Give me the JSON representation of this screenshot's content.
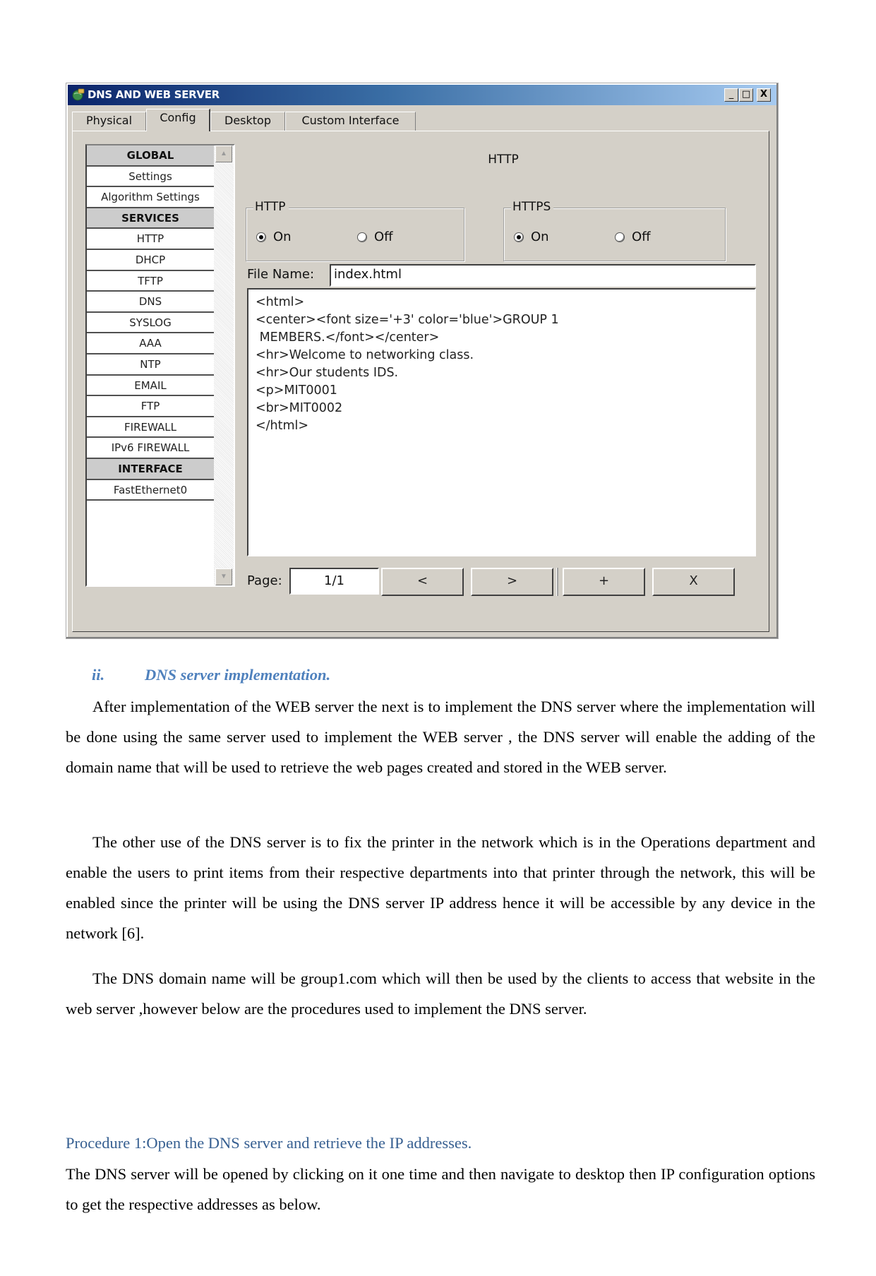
{
  "window": {
    "title": "DNS AND WEB SERVER",
    "title_icon": "server-globe-icon",
    "controls": {
      "minimize": "_",
      "maximize": "□",
      "close": "X"
    },
    "tabs": [
      {
        "label": "Physical",
        "active": false
      },
      {
        "label": "Config",
        "active": true
      },
      {
        "label": "Desktop",
        "active": false
      },
      {
        "label": "Custom Interface",
        "active": false
      }
    ],
    "sidebar": {
      "items": [
        {
          "label": "GLOBAL",
          "type": "section"
        },
        {
          "label": "Settings",
          "type": "item"
        },
        {
          "label": "Algorithm Settings",
          "type": "item"
        },
        {
          "label": "SERVICES",
          "type": "section"
        },
        {
          "label": "HTTP",
          "type": "item"
        },
        {
          "label": "DHCP",
          "type": "item"
        },
        {
          "label": "TFTP",
          "type": "item"
        },
        {
          "label": "DNS",
          "type": "item"
        },
        {
          "label": "SYSLOG",
          "type": "item"
        },
        {
          "label": "AAA",
          "type": "item"
        },
        {
          "label": "NTP",
          "type": "item"
        },
        {
          "label": "EMAIL",
          "type": "item"
        },
        {
          "label": "FTP",
          "type": "item"
        },
        {
          "label": "FIREWALL",
          "type": "item"
        },
        {
          "label": "IPv6 FIREWALL",
          "type": "item"
        },
        {
          "label": "INTERFACE",
          "type": "section"
        },
        {
          "label": "FastEthernet0",
          "type": "item"
        }
      ],
      "scroll_up": "▲",
      "scroll_down": "▼"
    },
    "content": {
      "heading": "HTTP",
      "http_group": {
        "legend": "HTTP",
        "on_label": "On",
        "off_label": "Off",
        "selected": "On"
      },
      "https_group": {
        "legend": "HTTPS",
        "on_label": "On",
        "off_label": "Off",
        "selected": "On"
      },
      "file_name_label": "File Name:",
      "file_name_value": "index.html",
      "editor_lines": [
        "<html>",
        "<center><font size='+3' color='blue'>GROUP 1",
        " MEMBERS.</font></center>",
        "<hr>Welcome to networking class.",
        "<hr>Our students IDS.",
        "<p>MIT0001",
        "<br>MIT0002",
        "</html>"
      ],
      "page_label": "Page:",
      "page_value": "1/1",
      "buttons": {
        "prev": "<",
        "next": ">",
        "add": "+",
        "delete": "X"
      }
    }
  },
  "document": {
    "section_number": "ii.",
    "section_title": "DNS server implementation.",
    "paragraphs": [
      "After implementation of the WEB server the next is to implement the DNS server where the implementation will be done using the same server used to implement the WEB server , the DNS server will enable the adding of the domain name that will be used to retrieve the web pages created and stored in the WEB server.",
      "The other use of the DNS server is to fix the printer in the network which is in the Operations department and enable the users to print items from their respective departments into that printer through the network, this will be enabled since the printer will be using the DNS server IP address hence it will be accessible by any device in the network [6].",
      "The DNS domain name will be group1.com which will then be used by the clients to access that website in the web server ,however below are the procedures used to implement the DNS server."
    ],
    "procedure_heading": "Procedure 1:Open the DNS server  and retrieve the IP addresses.",
    "procedure_text": "The DNS server will be opened by clicking on it one time and then navigate to desktop then IP configuration options to get the respective addresses as below.",
    "colors": {
      "section_heading": "#4f81bd",
      "procedure_heading": "#365f91"
    }
  }
}
